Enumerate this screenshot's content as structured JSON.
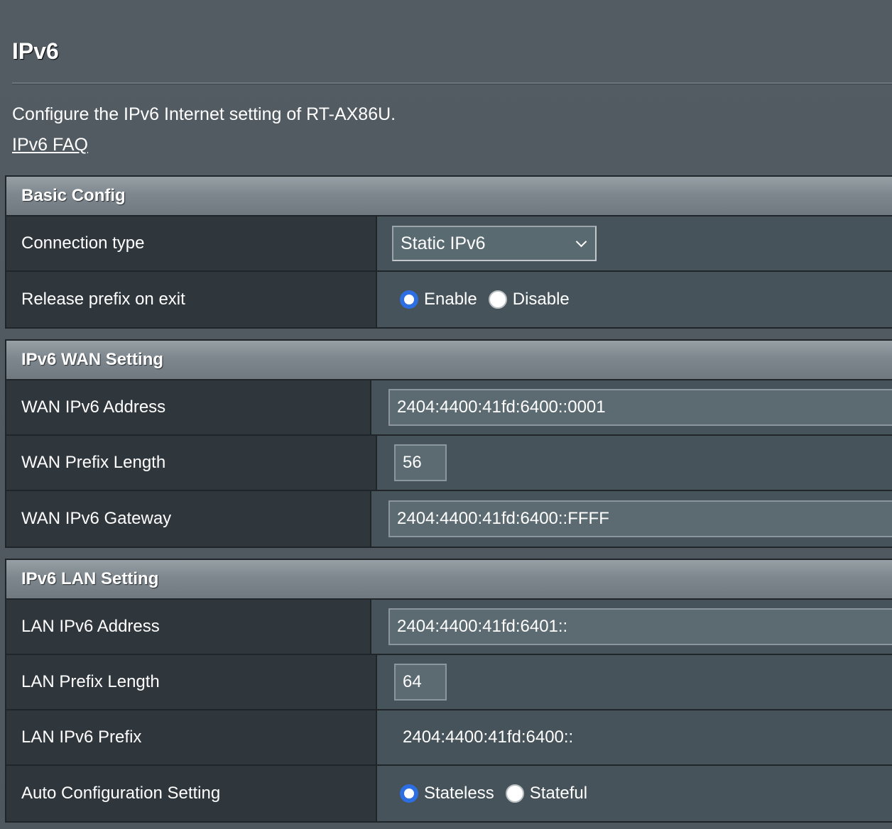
{
  "page": {
    "title": "IPv6",
    "description": "Configure the IPv6 Internet setting of RT-AX86U.",
    "faq_link": "IPv6 FAQ"
  },
  "basic_config": {
    "header": "Basic Config",
    "connection_type": {
      "label": "Connection type",
      "selected": "Static IPv6"
    },
    "release_prefix": {
      "label": "Release prefix on exit",
      "options": [
        "Enable",
        "Disable"
      ],
      "selected": "Enable"
    }
  },
  "wan_setting": {
    "header": "IPv6 WAN Setting",
    "wan_address": {
      "label": "WAN IPv6 Address",
      "value": "2404:4400:41fd:6400::0001"
    },
    "wan_prefix_length": {
      "label": "WAN Prefix Length",
      "value": "56"
    },
    "wan_gateway": {
      "label": "WAN IPv6 Gateway",
      "value": "2404:4400:41fd:6400::FFFF"
    }
  },
  "lan_setting": {
    "header": "IPv6 LAN Setting",
    "lan_address": {
      "label": "LAN IPv6 Address",
      "value": "2404:4400:41fd:6401::"
    },
    "lan_prefix_length": {
      "label": "LAN Prefix Length",
      "value": "64"
    },
    "lan_prefix": {
      "label": "LAN IPv6 Prefix",
      "value": "2404:4400:41fd:6400::"
    },
    "auto_config": {
      "label": "Auto Configuration Setting",
      "options": [
        "Stateless",
        "Stateful"
      ],
      "selected": "Stateless"
    }
  },
  "colors": {
    "background": "#535c63",
    "radio_checked": "#2d6fe0",
    "section_header": "#7d878d",
    "label_cell": "#2f363c",
    "value_cell": "#46535a"
  }
}
